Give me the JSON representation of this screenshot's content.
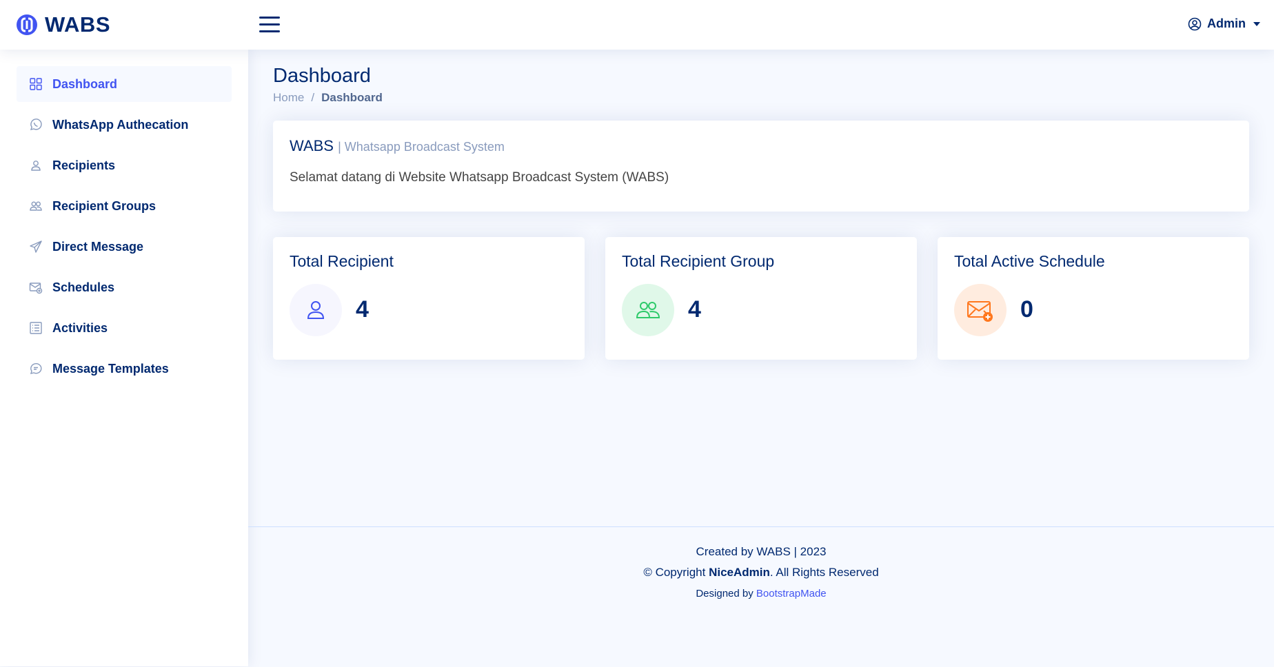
{
  "app": {
    "name": "WABS"
  },
  "header": {
    "user_name": "Admin"
  },
  "sidebar": {
    "items": [
      {
        "label": "Dashboard",
        "icon": "grid-icon"
      },
      {
        "label": "WhatsApp Authecation",
        "icon": "whatsapp-icon"
      },
      {
        "label": "Recipients",
        "icon": "person-icon"
      },
      {
        "label": "Recipient Groups",
        "icon": "people-icon"
      },
      {
        "label": "Direct Message",
        "icon": "send-icon"
      },
      {
        "label": "Schedules",
        "icon": "envelope-plus-icon"
      },
      {
        "label": "Activities",
        "icon": "list-icon"
      },
      {
        "label": "Message Templates",
        "icon": "chat-icon"
      }
    ],
    "active": "Dashboard"
  },
  "page": {
    "title": "Dashboard",
    "breadcrumb": {
      "home": "Home",
      "separator": "/",
      "current": "Dashboard"
    }
  },
  "welcome": {
    "title": "WABS",
    "subtitle": "| Whatsapp Broadcast System",
    "text": "Selamat datang di Website Whatsapp Broadcast System (WABS)"
  },
  "stats": [
    {
      "title": "Total Recipient",
      "value": "4",
      "icon": "person-icon",
      "bg": "#f6f6fe",
      "color": "#4154f1"
    },
    {
      "title": "Total Recipient Group",
      "value": "4",
      "icon": "people-icon",
      "bg": "#e0f8e9",
      "color": "#2eca6a"
    },
    {
      "title": "Total Active Schedule",
      "value": "0",
      "icon": "envelope-plus-icon",
      "bg": "#ffecdf",
      "color": "#ff771d"
    }
  ],
  "footer": {
    "created": "Created by WABS | 2023",
    "copyright_prefix": "© Copyright",
    "copyright_brand": "NiceAdmin",
    "copyright_suffix": ". All Rights Reserved",
    "designed_prefix": "Designed by",
    "designed_link": "BootstrapMade"
  },
  "colors": {
    "accent": "#4154f1",
    "text": "#012970",
    "background": "#f6f9ff"
  }
}
